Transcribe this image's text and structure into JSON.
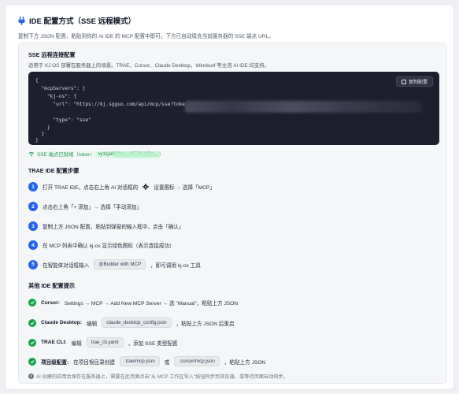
{
  "header": {
    "title": "IDE 配置方式（SSE 远程模式）",
    "description": "复制下方 JSON 配置，粘贴到你的 AI IDE 的 MCP 配置中即可。下方已自动填充当前服务器的 SSE 端点 URL。"
  },
  "sse": {
    "title": "SSE 远程连接配置",
    "subtitle": "适用于 KJ OS 部署在服务器上的场景。TRAE、Cursor、Claude Desktop、Windsurf 等主流 AI IDE 均支持。",
    "copy_label": "复制配置",
    "code_lines": [
      "{",
      "  \"mcpServers\": {",
      "    \"kj-os\": {",
      "      \"url\": \"https://kj.sgguo.com/api/mcp/sse?toke",
      "      \"type\": \"sse\"",
      "    }",
      "  }",
      "}"
    ],
    "connection_status": "SSE 端点已就绪（token:",
    "token_text": "vy11jsi8WNw...IAEXWxBX",
    "connection_close": "）"
  },
  "trae": {
    "title": "TRAE IDE 配置步骤",
    "steps": [
      {
        "num": "1",
        "text_a": "打开 TRAE IDE，点击右上角 AI 对话框的",
        "text_b": "设置图标 → 选择「MCP」"
      },
      {
        "num": "2",
        "text": "点击右上角「+ 添加」→ 选择「手动添加」"
      },
      {
        "num": "3",
        "text": "复制上方 JSON 配置，粘贴到弹窗的输入框中，点击「确认」"
      },
      {
        "num": "4",
        "text": "在 MCP 列表中确认 kj-os 显示绿色图标（表示连接成功）"
      },
      {
        "num": "5",
        "text_a": "在智能体对话框输入",
        "chip": "@Builder with MCP",
        "text_b": "，即可调用 kj-os 工具"
      }
    ]
  },
  "other": {
    "title": "其他 IDE 配置提示",
    "items": [
      {
        "label": "Cursor:",
        "text": "Settings → MCP → Add New MCP Server → 选 \"Manual\"，粘贴上方 JSON"
      },
      {
        "label": "Claude Desktop:",
        "text_a": "编辑",
        "chip": "claude_desktop_config.json",
        "text_b": "，粘贴上方 JSON 后重启"
      },
      {
        "label": "TRAE CLI:",
        "text_a": "编辑",
        "chip": "trae_cli.yaml",
        "text_b": "，添加 SSE 类型配置"
      },
      {
        "label": "项目级配置:",
        "text_a": "在项目根目录创建",
        "chip": ".trae/mcp.json",
        "text_mid": "或",
        "chip2": ".cursor/mcp.json",
        "text_b": "，粘贴上方 JSON"
      }
    ]
  },
  "footer_note": "AI 创建的应用会保存在服务器上，需要在此页面点击\"从 MCP 工作区导入\"按钮同步到浏览器，或等待页面自动同步。",
  "colors": {
    "accent_blue": "#2563eb",
    "success_green": "#16a34a",
    "code_bg": "#1e1f2e"
  }
}
